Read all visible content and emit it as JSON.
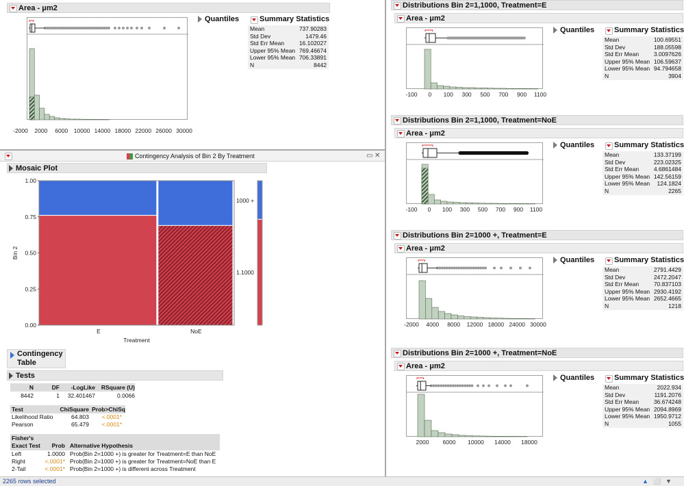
{
  "colors": {
    "hist_fill": "#c2d2c0",
    "hist_stroke": "#5a6b58",
    "hatch_dark": "#3f5e3f",
    "mosaic_red": "#d1444f",
    "mosaic_blue": "#3f6edb",
    "significant": "#d68a12"
  },
  "common": {
    "quantiles_label": "Quantiles",
    "summary_label": "Summary Statistics",
    "stat_labels": [
      "Mean",
      "Std Dev",
      "Std Err Mean",
      "Upper 95% Mean",
      "Lower 95% Mean",
      "N"
    ]
  },
  "left_top": {
    "title": "Area - μm2",
    "stats": [
      "737.90283",
      "1479.46",
      "16.102027",
      "769.46674",
      "706.33891",
      "8442"
    ],
    "ticks": [
      "-2000",
      "2000",
      "6000",
      "10000",
      "14000",
      "18000",
      "22000",
      "26000",
      "30000"
    ]
  },
  "contingency_window": {
    "title": "Contingency Analysis of Bin 2 By Treatment",
    "window_icons": [
      "▭",
      "✕"
    ]
  },
  "mosaic": {
    "title": "Mosaic Plot",
    "ylabel": "Bin 2",
    "xlabel": "Treatment",
    "y_ticks": [
      "1.00",
      "0.75",
      "0.50",
      "0.25",
      "0.00"
    ],
    "categories": [
      "E",
      "NoE"
    ],
    "right_labels": [
      "1000 +",
      "1.1000"
    ]
  },
  "chart_data": {
    "type": "bar",
    "title": "Mosaic Plot",
    "xlabel": "Treatment",
    "ylabel": "Bin 2",
    "categories": [
      "E",
      "NoE"
    ],
    "series": [
      {
        "name": "1.1000",
        "values": [
          0.76,
          0.69
        ]
      },
      {
        "name": "1000 +",
        "values": [
          0.24,
          0.31
        ]
      }
    ],
    "ylim": [
      0,
      1
    ]
  },
  "contingency_table": {
    "title": "Contingency Table"
  },
  "tests": {
    "title": "Tests",
    "header": [
      "N",
      "DF",
      "-LogLike",
      "RSquare (U)"
    ],
    "row": [
      "8442",
      "1",
      "32.401467",
      "0.0066"
    ],
    "test_header": [
      "Test",
      "ChiSquare",
      "Prob>ChiSq"
    ],
    "test_rows": [
      [
        "Likelihood Ratio",
        "64.803",
        "<.0001*"
      ],
      [
        "Pearson",
        "65.479",
        "<.0001*"
      ]
    ],
    "fisher_header": [
      "Fisher's",
      "Exact Test",
      "Prob",
      "Alternative Hypothesis"
    ],
    "fisher_rows": [
      [
        "Left",
        "1.0000",
        "Prob(Bin 2=1000 +) is greater for Treatment=E than NoE"
      ],
      [
        "Right",
        "<.0001*",
        "Prob(Bin 2=1000 +) is greater for Treatment=NoE than E"
      ],
      [
        "2-Tail",
        "<.0001*",
        "Prob(Bin 2=1000 +) is different across Treatment"
      ]
    ]
  },
  "right_panels": [
    {
      "title": "Distributions Bin 2=1,1000, Treatment=E",
      "area_title": "Area - μm2",
      "stats": [
        "100.69551",
        "188.05598",
        "3.0097626",
        "106.59637",
        "94.794658",
        "3904"
      ],
      "ticks": [
        "-100",
        "0",
        "100",
        "300",
        "500",
        "700",
        "900",
        "1100"
      ]
    },
    {
      "title": "Distributions Bin 2=1,1000, Treatment=NoE",
      "area_title": "Area - μm2",
      "stats": [
        "133.37199",
        "223.02325",
        "4.6861484",
        "142.56159",
        "124.1824",
        "2265"
      ],
      "ticks": [
        "-100",
        "0",
        "100",
        "300",
        "500",
        "700",
        "900",
        "1100"
      ]
    },
    {
      "title": "Distributions Bin 2=1000 +, Treatment=E",
      "area_title": "Area - μm2",
      "stats": [
        "2791.4429",
        "2472.2047",
        "70.837103",
        "2930.4192",
        "2652.4665",
        "1218"
      ],
      "ticks": [
        "-2000",
        "4000",
        "8000",
        "12000",
        "18000",
        "24000",
        "30000"
      ]
    },
    {
      "title": "Distributions Bin 2=1000 +, Treatment=NoE",
      "area_title": "Area - μm2",
      "stats": [
        "2022.934",
        "1191.2076",
        "36.674248",
        "2094.8969",
        "1950.9712",
        "1055"
      ],
      "ticks": [
        "2000",
        "6000",
        "10000",
        "14000",
        "18000"
      ]
    }
  ],
  "status": {
    "text": "2265 rows selected",
    "icons": [
      "▲",
      "⬜",
      "▼"
    ]
  }
}
